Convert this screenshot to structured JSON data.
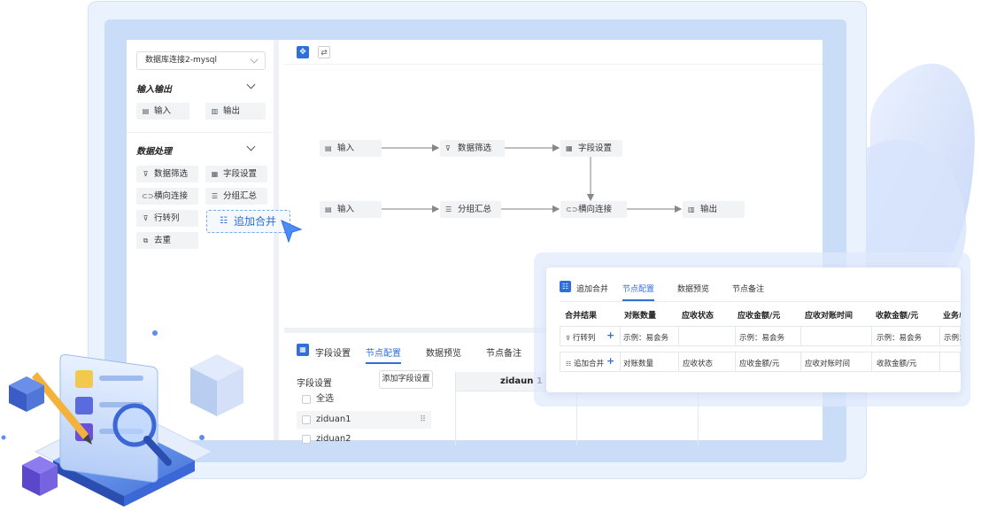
{
  "sidebar": {
    "db_select": "数据库连接2-mysql",
    "sections": [
      {
        "title": "输入输出",
        "items": [
          {
            "label": "输入",
            "icon": "database-icon"
          },
          {
            "label": "输出",
            "icon": "export-icon"
          }
        ]
      },
      {
        "title": "数据处理",
        "items": [
          {
            "label": "数据筛选",
            "icon": "filter-icon"
          },
          {
            "label": "字段设置",
            "icon": "field-settings-icon"
          },
          {
            "label": "横向连接",
            "icon": "link-icon"
          },
          {
            "label": "分组汇总",
            "icon": "list-icon"
          },
          {
            "label": "行转列",
            "icon": "pivot-icon"
          },
          {
            "label": "去重",
            "icon": "copy-icon"
          }
        ]
      }
    ],
    "dragging": {
      "label": "追加合并",
      "icon": "merge-icon"
    }
  },
  "flow": {
    "row1": [
      "输入",
      "数据筛选",
      "字段设置"
    ],
    "row2": [
      "输入",
      "分组汇总",
      "横向连接",
      "输出"
    ]
  },
  "bottom_panel": {
    "title": "字段设置",
    "tabs": [
      "节点配置",
      "数据预览",
      "节点备注"
    ],
    "active_tab": "节点配置",
    "list_title": "字段设置",
    "add_button": "添加字段设置",
    "rows": [
      "全选",
      "ziduan1",
      "ziduan2"
    ],
    "grid_header": "zidaun 1"
  },
  "card": {
    "title": "追加合并",
    "tabs": [
      "节点配置",
      "数据预览",
      "节点备注"
    ],
    "active_tab": "节点配置",
    "headers": [
      "合并结果",
      "对账数量",
      "应收状态",
      "应收金额/元",
      "应收对账时间",
      "收款金额/元",
      "业务单"
    ],
    "rows": [
      {
        "label": "行转列",
        "cells": [
          "示例：易会务",
          "",
          "示例：易会务",
          "",
          "示例：易会务",
          "示例："
        ]
      },
      {
        "label": "追加合并",
        "cells": [
          "对账数量",
          "应收状态",
          "应收金额/元",
          "应收对账时间",
          "收款金额/元",
          ""
        ]
      }
    ]
  },
  "colors": {
    "accent": "#2f6fdc",
    "frame": "#c9dcf8"
  }
}
